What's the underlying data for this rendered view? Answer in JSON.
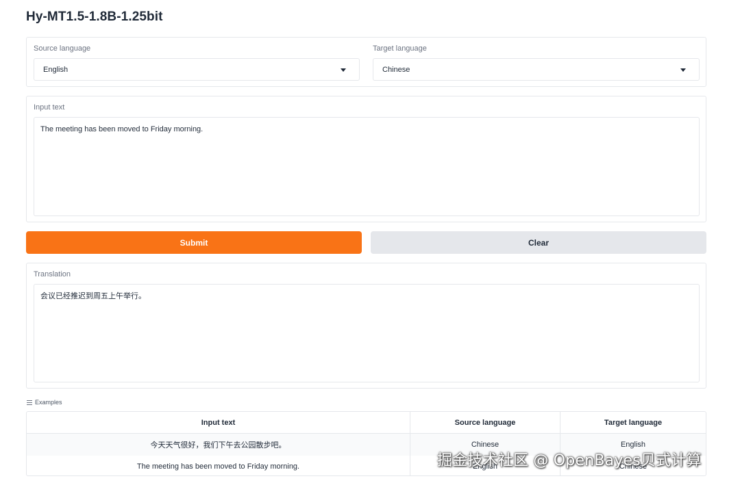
{
  "app": {
    "title": "Hy-MT1.5-1.8B-1.25bit"
  },
  "languages": {
    "source_label": "Source language",
    "source_value": "English",
    "target_label": "Target language",
    "target_value": "Chinese"
  },
  "input": {
    "label": "Input text",
    "value": "The meeting has been moved to Friday morning."
  },
  "buttons": {
    "submit": "Submit",
    "clear": "Clear"
  },
  "output": {
    "label": "Translation",
    "value": "会议已经推迟到周五上午举行。"
  },
  "examples": {
    "label": "Examples",
    "columns": [
      "Input text",
      "Source language",
      "Target language"
    ],
    "rows": [
      [
        "今天天气很好，我们下午去公园散步吧。",
        "Chinese",
        "English"
      ],
      [
        "The meeting has been moved to Friday morning.",
        "English",
        "Chinese"
      ]
    ]
  },
  "watermark": {
    "text": "掘金技术社区 @ OpenBayes贝式计算"
  },
  "colors": {
    "accent": "#f97316",
    "secondary_button": "#e5e7eb",
    "border": "#e5e7eb"
  },
  "icons": {
    "dropdown": "caret-down-icon",
    "examples": "list-icon"
  }
}
